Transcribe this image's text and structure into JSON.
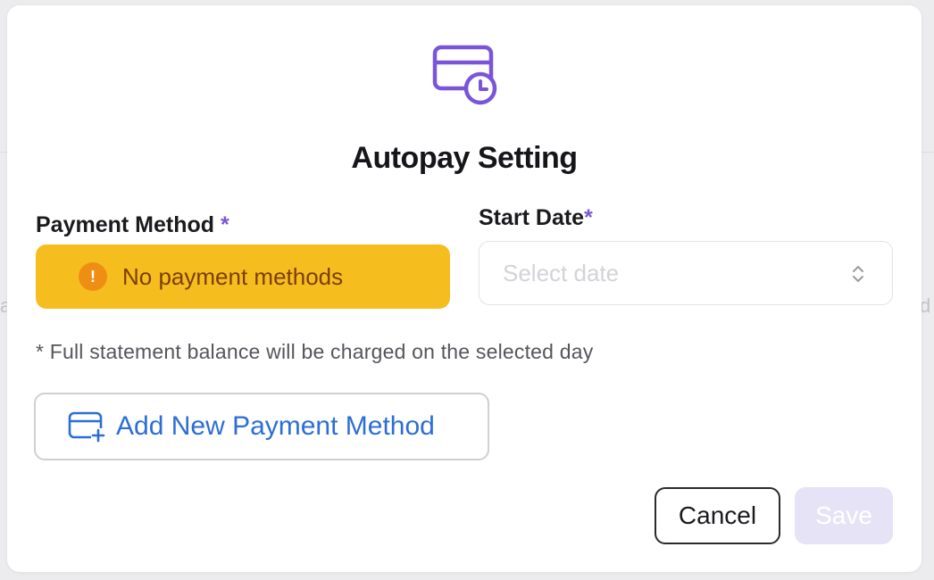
{
  "modal": {
    "title": "Autopay Setting",
    "hero_icon": "card-clock-icon"
  },
  "payment_method": {
    "label": "Payment Method",
    "required_mark": "*",
    "alert_icon": "exclamation-circle-icon",
    "alert_symbol": "!",
    "alert_text": "No payment methods"
  },
  "start_date": {
    "label": "Start Date",
    "required_mark": "*",
    "placeholder": "Select date",
    "chevron_icon": "chevrons-up-down-icon"
  },
  "note": "* Full statement balance will be charged on the selected day",
  "add_method": {
    "icon": "card-plus-icon",
    "label": "Add New Payment Method"
  },
  "actions": {
    "cancel_label": "Cancel",
    "save_label": "Save",
    "save_disabled": true
  },
  "colors": {
    "accent_purple": "#7a55d9",
    "alert_bg": "#f6bd1f",
    "alert_icon_bg": "#ef8e14",
    "link_blue": "#2c6ed4",
    "save_disabled_bg": "#e7e3f7"
  }
}
